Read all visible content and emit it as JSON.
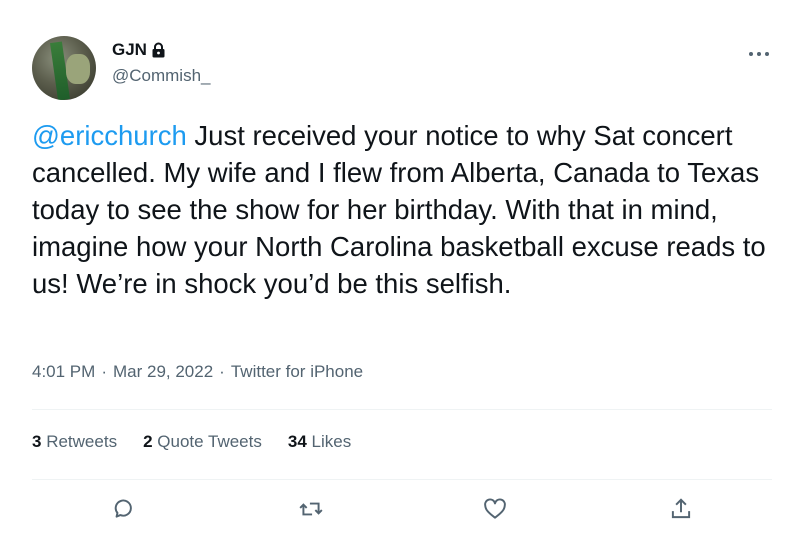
{
  "user": {
    "name": "GJN",
    "handle": "@Commish_"
  },
  "tweet": {
    "mention": "@ericchurch",
    "text": " Just received your notice to why Sat concert cancelled. My wife and I flew from Alberta, Canada to Texas today to see the show for her birthday. With that in mind, imagine how your North Carolina basketball excuse reads to us! We’re in shock you’d be this selfish."
  },
  "meta": {
    "time": "4:01 PM",
    "sep1": "·",
    "date": "Mar 29, 2022",
    "sep2": "·",
    "source": "Twitter for iPhone"
  },
  "stats": {
    "retweets_count": "3",
    "retweets_label": "Retweets",
    "quotes_count": "2",
    "quotes_label": "Quote Tweets",
    "likes_count": "34",
    "likes_label": "Likes"
  },
  "icons": {
    "lock": "lock-icon",
    "more": "more-icon",
    "reply": "reply-icon",
    "retweet": "retweet-icon",
    "like": "heart-icon",
    "share": "share-icon"
  },
  "colors": {
    "text": "#0f1419",
    "secondary": "#536471",
    "accent": "#1d9bf0",
    "divider": "#eff3f4"
  }
}
